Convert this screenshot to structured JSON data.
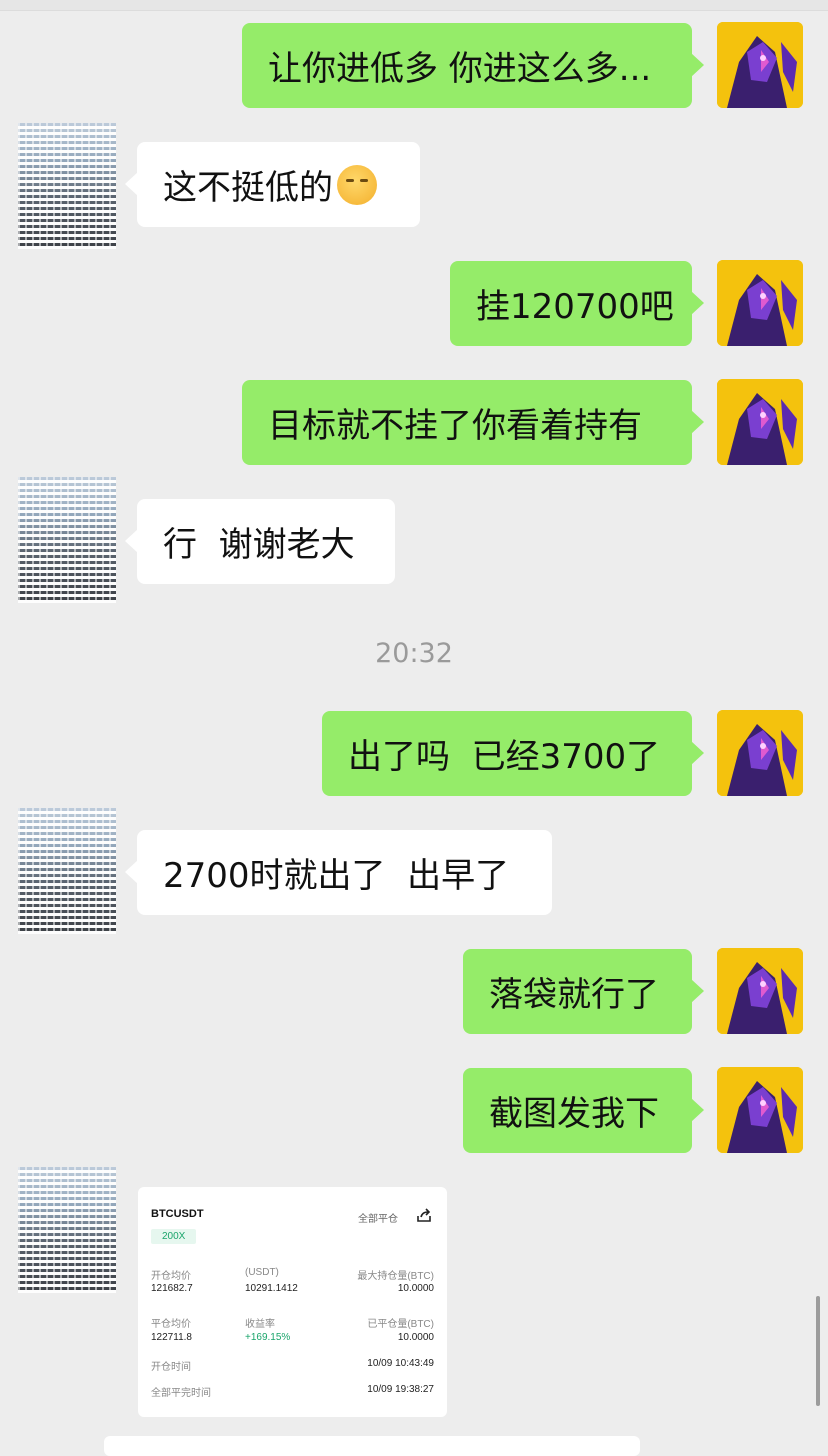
{
  "chat": {
    "timestamp": "20:32",
    "messages": [
      {
        "side": "me",
        "text": "让你进低多 你进这么多..."
      },
      {
        "side": "them",
        "text": "这不挺低的",
        "emoji": "face-with-hand-over-mouth"
      },
      {
        "side": "me",
        "text": "挂120700吧"
      },
      {
        "side": "me",
        "text": "目标就不挂了你看着持有"
      },
      {
        "side": "them",
        "text": "行  谢谢老大"
      },
      {
        "side": "me",
        "text": "出了吗  已经3700了"
      },
      {
        "side": "them",
        "text": "2700时就出了  出早了"
      },
      {
        "side": "me",
        "text": "落袋就行了"
      },
      {
        "side": "me",
        "text": "截图发我下"
      }
    ]
  },
  "trade_card": {
    "pair": "BTCUSDT",
    "close_all_label": "全部平仓",
    "leverage": "200X",
    "open_avg_label": "开仓均价",
    "open_avg_value": "121682.7",
    "pnl_unit_label": "(USDT)",
    "pnl_value": "10291.1412",
    "max_position_label": "最大持仓量(BTC)",
    "max_position_value": "10.0000",
    "close_avg_label": "平仓均价",
    "close_avg_value": "122711.8",
    "return_rate_label": "收益率",
    "return_rate_value": "+169.15%",
    "closed_qty_label": "已平仓量(BTC)",
    "closed_qty_value": "10.0000",
    "open_time_label": "开仓时间",
    "open_time_value": "10/09 10:43:49",
    "full_close_time_label": "全部平完时间",
    "full_close_time_value": "10/09 19:38:27"
  },
  "colors": {
    "background": "#ededed",
    "my_bubble": "#95ec69",
    "their_bubble": "#ffffff",
    "positive": "#1aa56b"
  }
}
